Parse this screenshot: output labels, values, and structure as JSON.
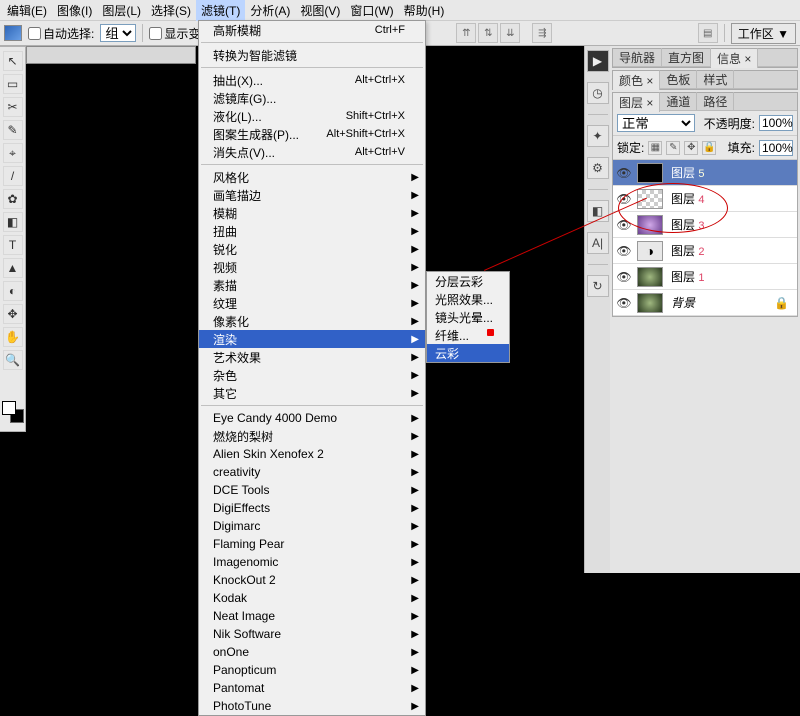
{
  "menubar": [
    "编辑(E)",
    "图像(I)",
    "图层(L)",
    "选择(S)",
    "滤镜(T)",
    "分析(A)",
    "视图(V)",
    "窗口(W)",
    "帮助(H)"
  ],
  "optionbar": {
    "auto_select": "自动选择:",
    "group": "组",
    "show_transform": "显示变",
    "workspace": "工作区 ▼"
  },
  "toolbox": [
    "↖",
    "▭",
    "✂",
    "✎",
    "⌖",
    "/",
    "✿",
    "◧",
    "T",
    "▲",
    "◐",
    "✥",
    "✋",
    "🔍"
  ],
  "filter_menu": {
    "top": [
      {
        "label": "高斯模糊",
        "shortcut": "Ctrl+F"
      }
    ],
    "convert": "转换为智能滤镜",
    "group2": [
      {
        "label": "抽出(X)...",
        "shortcut": "Alt+Ctrl+X"
      },
      {
        "label": "滤镜库(G)..."
      },
      {
        "label": "液化(L)...",
        "shortcut": "Shift+Ctrl+X"
      },
      {
        "label": "图案生成器(P)...",
        "shortcut": "Alt+Shift+Ctrl+X"
      },
      {
        "label": "消失点(V)...",
        "shortcut": "Alt+Ctrl+V"
      }
    ],
    "group3": [
      "风格化",
      "画笔描边",
      "模糊",
      "扭曲",
      "锐化",
      "视频",
      "素描",
      "纹理",
      "像素化",
      "渲染",
      "艺术效果",
      "杂色",
      "其它"
    ],
    "group3_highlight": "渲染",
    "group4": [
      "Eye Candy 4000 Demo",
      "燃烧的梨树",
      "Alien Skin Xenofex 2",
      "creativity",
      "DCE Tools",
      "DigiEffects",
      "Digimarc",
      "Flaming Pear",
      "Imagenomic",
      "KnockOut 2",
      "Kodak",
      "Neat Image",
      "Nik Software",
      "onOne",
      "Panopticum",
      "Pantomat",
      "PhotoTune"
    ]
  },
  "sub_menu": {
    "items": [
      "分层云彩",
      "光照效果...",
      "镜头光晕...",
      "纤维...",
      "云彩"
    ],
    "highlight": "云彩"
  },
  "panels": {
    "nav_tabs": [
      "导航器",
      "直方图",
      "信息 ×"
    ],
    "color_tabs": [
      "颜色 ×",
      "色板",
      "样式"
    ],
    "layer_tabs": [
      "图层 ×",
      "通道",
      "路径"
    ],
    "blend_mode": "正常",
    "opacity_lbl": "不透明度:",
    "opacity_val": "100%",
    "lock_lbl": "锁定:",
    "fill_lbl": "填充:",
    "fill_val": "100%",
    "layers": [
      {
        "name": "图层",
        "num": "5",
        "thumb": "black",
        "selected": true
      },
      {
        "name": "图层",
        "num": "4",
        "thumb": "checker"
      },
      {
        "name": "图层",
        "num": "3",
        "thumb": "purple"
      },
      {
        "name": "图层",
        "num": "2",
        "thumb": "adjustment"
      },
      {
        "name": "图层",
        "num": "1",
        "thumb": "land"
      },
      {
        "name": "背景",
        "thumb": "land",
        "italic": true,
        "lock": true
      }
    ]
  }
}
